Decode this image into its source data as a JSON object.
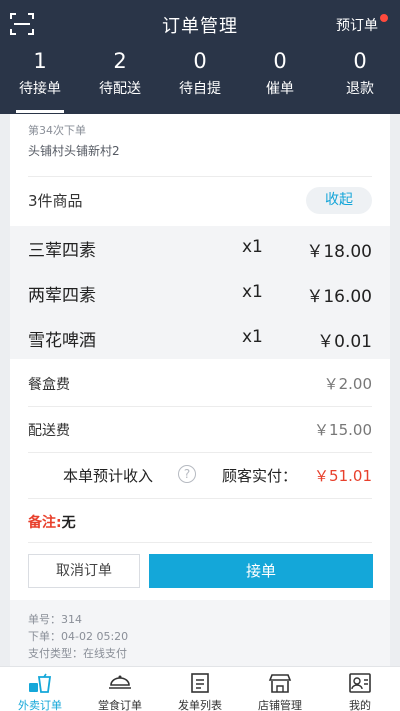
{
  "header": {
    "title": "订单管理",
    "preorder_label": "预订单",
    "scan_icon": "scan-icon"
  },
  "status_tabs": [
    {
      "count": "1",
      "label": "待接单",
      "active": true
    },
    {
      "count": "2",
      "label": "待配送",
      "active": false
    },
    {
      "count": "0",
      "label": "待自提",
      "active": false
    },
    {
      "count": "0",
      "label": "催单",
      "active": false
    },
    {
      "count": "0",
      "label": "退款",
      "active": false
    }
  ],
  "order": {
    "order_times": "第34次下单",
    "address": "头铺村头铺新村2",
    "goods_count": "3件商品",
    "collapse_label": "收起",
    "items": [
      {
        "name": "三荤四素",
        "qty": "x1",
        "price": "￥18.00"
      },
      {
        "name": "两荤四素",
        "qty": "x1",
        "price": "￥16.00"
      },
      {
        "name": "雪花啤酒",
        "qty": "x1",
        "price": "￥0.01"
      }
    ],
    "fees": [
      {
        "label": "餐盒费",
        "value": "￥2.00"
      },
      {
        "label": "配送费",
        "value": "￥15.00"
      }
    ],
    "income_label": "本单预计收入",
    "paid_label": "顾客实付：",
    "paid_value": "￥51.01",
    "remark_label": "备注:",
    "remark_value": "无",
    "cancel_label": "取消订单",
    "accept_label": "接单",
    "order_no": "单号：314",
    "order_time": "下单：04-02 05:20",
    "pay_type": "支付类型：在线支付"
  },
  "bottom_nav": [
    {
      "label": "外卖订单",
      "icon": "takeout-cup-icon",
      "active": true
    },
    {
      "label": "堂食订单",
      "icon": "dish-icon",
      "active": false
    },
    {
      "label": "发单列表",
      "icon": "list-icon",
      "active": false
    },
    {
      "label": "店铺管理",
      "icon": "store-icon",
      "active": false
    },
    {
      "label": "我的",
      "icon": "profile-icon",
      "active": false
    }
  ],
  "colors": {
    "header_bg": "#2a3548",
    "accent": "#14a7d9",
    "price_red": "#e8402c"
  }
}
